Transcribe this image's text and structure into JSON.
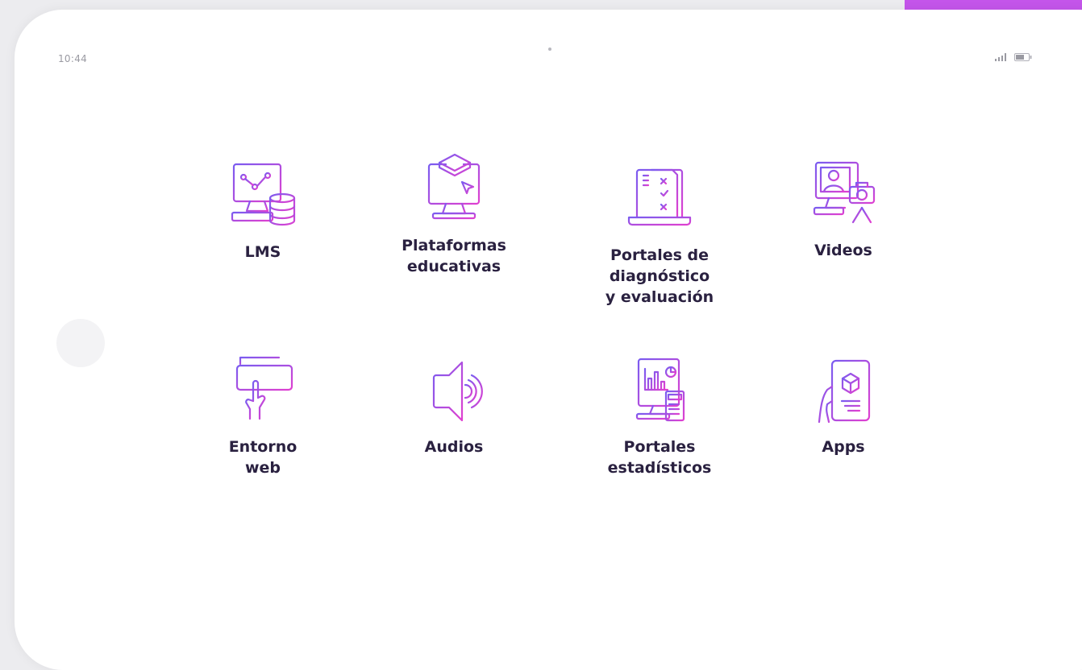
{
  "status_bar": {
    "time": "10:44",
    "signal_icon": "signal-icon",
    "battery_icon": "battery-icon"
  },
  "colors": {
    "accent_start": "#7a5cf0",
    "accent_end": "#e040d0",
    "label": "#2a2140"
  },
  "apps": [
    {
      "label": "LMS",
      "icon": "lms-database-icon"
    },
    {
      "label": "Plataformas\neducativas",
      "icon": "educational-platform-icon"
    },
    {
      "label": "Portales de\ndiagnóstico\ny evaluación",
      "icon": "assessment-portal-icon"
    },
    {
      "label": "Videos",
      "icon": "video-camera-icon"
    },
    {
      "label": "Entorno\nweb",
      "icon": "web-keyboard-icon"
    },
    {
      "label": "Audios",
      "icon": "speaker-icon"
    },
    {
      "label": "Portales\nestadísticos",
      "icon": "statistics-portal-icon"
    },
    {
      "label": "Apps",
      "icon": "mobile-app-icon"
    }
  ]
}
